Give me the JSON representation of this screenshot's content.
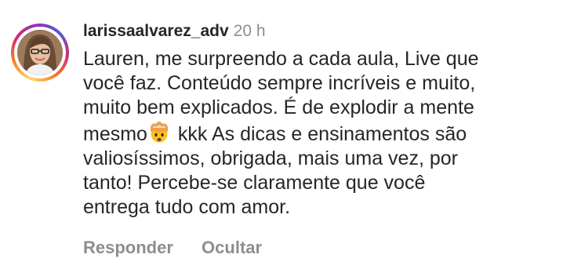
{
  "comment": {
    "username": "larissaalvarez_adv",
    "time": "20 h",
    "text_part1": "Lauren, me surpreendo a cada aula, Live que\nvocê faz. Conteúdo sempre incríveis e muito,\nmuito bem explicados. É de explodir a mente\nmesmo",
    "emoji": "exploding-head-emoji",
    "text_part2": " kkk As dicas e ensinamentos são\nvaliosíssimos, obrigada, mais uma vez, por\ntanto! Percebe-se claramente que você\nentrega tudo com amor.",
    "actions": {
      "reply_label": "Responder",
      "hide_label": "Ocultar"
    }
  },
  "colors": {
    "text": "#262626",
    "muted": "#8e8e8e",
    "background": "#ffffff"
  }
}
